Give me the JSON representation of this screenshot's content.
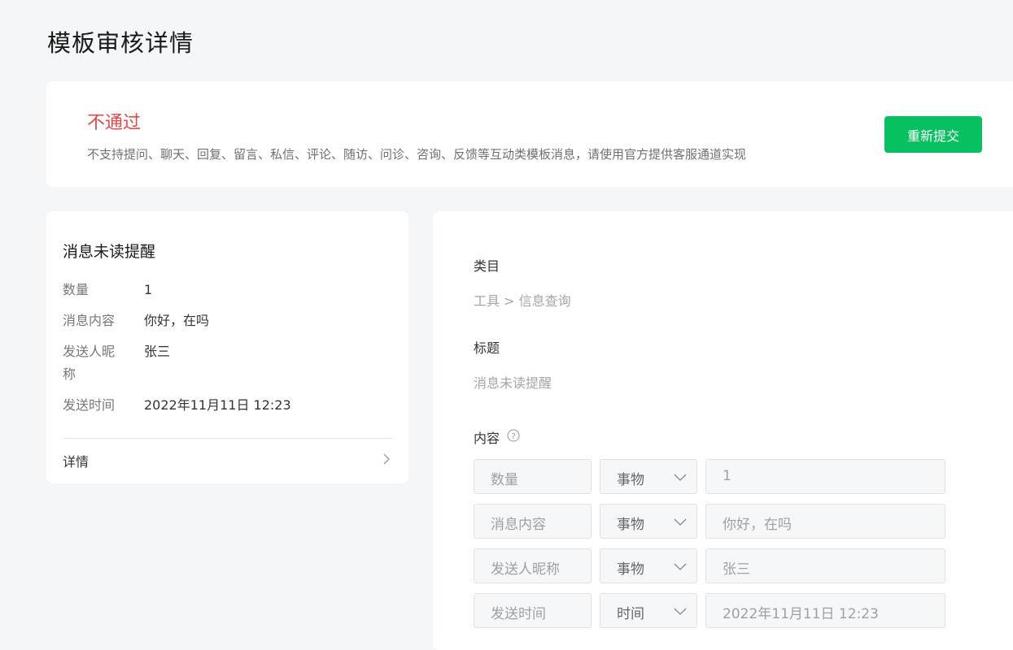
{
  "page": {
    "title": "模板审核详情"
  },
  "status": {
    "title": "不通过",
    "reason": "不支持提问、聊天、回复、留言、私信、评论、随访、问诊、咨询、反馈等互动类模板消息，请使用官方提供客服通道实现",
    "resubmit_label": "重新提交",
    "color": "#e5484d",
    "button_color": "#07c160"
  },
  "preview": {
    "title": "消息未读提醒",
    "fields": [
      {
        "key": "数量",
        "value": "1"
      },
      {
        "key": "消息内容",
        "value": "你好，在吗"
      },
      {
        "key": "发送人昵称",
        "value": "张三"
      },
      {
        "key": "发送时间",
        "value": "2022年11月11日 12:23"
      }
    ],
    "detail_label": "详情",
    "detail_icon": "chevron-right-icon"
  },
  "form": {
    "category_label": "类目",
    "category_value": "工具 > 信息查询",
    "title_label": "标题",
    "title_value": "消息未读提醒",
    "content_label": "内容",
    "help_icon": "question-circle-icon",
    "rows": [
      {
        "name": "数量",
        "type": "事物",
        "value": "1"
      },
      {
        "name": "消息内容",
        "type": "事物",
        "value": "你好，在吗"
      },
      {
        "name": "发送人昵称",
        "type": "事物",
        "value": "张三"
      },
      {
        "name": "发送时间",
        "type": "时间",
        "value": "2022年11月11日 12:23"
      }
    ]
  }
}
